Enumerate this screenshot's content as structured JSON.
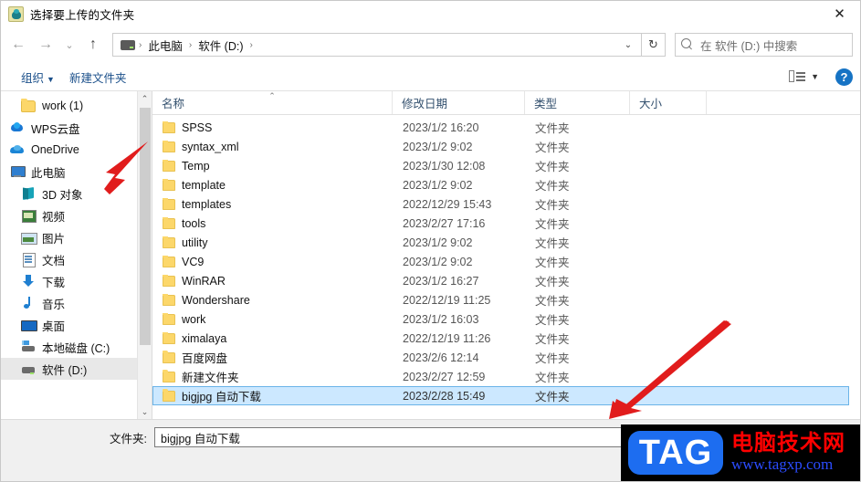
{
  "window": {
    "title": "选择要上传的文件夹",
    "title_icon": "app-icon",
    "close_label": "✕"
  },
  "nav": {
    "back_label": "←",
    "forward_label": "→",
    "history_label": "⌄",
    "up_label": "↑",
    "refresh_label": "↻",
    "dropdown_label": "⌄",
    "breadcrumb": [
      {
        "label": "此电脑"
      },
      {
        "label": "软件 (D:)"
      }
    ],
    "separator": "›"
  },
  "search": {
    "placeholder": "在 软件 (D:) 中搜索",
    "icon": "search-icon"
  },
  "toolbar": {
    "organize_label": "组织",
    "organize_caret": "▼",
    "new_folder_label": "新建文件夹",
    "view_caret": "▼",
    "help_label": "?"
  },
  "sidebar": {
    "items": [
      {
        "label": "work (1)",
        "icon": "folder-icon",
        "icon_class": "ico-folder",
        "indent": "sb-indent",
        "selected": false
      },
      {
        "label": "WPS云盘",
        "icon": "wps-cloud-icon",
        "icon_class": "ico-wps",
        "indent": "sb-root",
        "selected": false
      },
      {
        "label": "OneDrive",
        "icon": "onedrive-icon",
        "icon_class": "ico-onedrive",
        "indent": "sb-root",
        "selected": false
      },
      {
        "label": "此电脑",
        "icon": "this-pc-icon",
        "icon_class": "ico-pc",
        "indent": "sb-root",
        "selected": false
      },
      {
        "label": "3D 对象",
        "icon": "3d-objects-icon",
        "icon_class": "ico-3d",
        "indent": "sb-indent",
        "selected": false
      },
      {
        "label": "视频",
        "icon": "videos-icon",
        "icon_class": "ico-video",
        "indent": "sb-indent",
        "selected": false
      },
      {
        "label": "图片",
        "icon": "pictures-icon",
        "icon_class": "ico-pic",
        "indent": "sb-indent",
        "selected": false
      },
      {
        "label": "文档",
        "icon": "documents-icon",
        "icon_class": "ico-doc",
        "indent": "sb-indent",
        "selected": false
      },
      {
        "label": "下载",
        "icon": "downloads-icon",
        "icon_class": "ico-dl",
        "indent": "sb-indent",
        "selected": false
      },
      {
        "label": "音乐",
        "icon": "music-icon",
        "icon_class": "ico-music",
        "indent": "sb-indent",
        "selected": false
      },
      {
        "label": "桌面",
        "icon": "desktop-icon",
        "icon_class": "ico-desk",
        "indent": "sb-indent",
        "selected": false
      },
      {
        "label": "本地磁盘 (C:)",
        "icon": "local-disk-icon",
        "icon_class": "ico-diskc",
        "indent": "sb-indent",
        "selected": false
      },
      {
        "label": "软件 (D:)",
        "icon": "drive-icon",
        "icon_class": "ico-disk",
        "indent": "sb-indent",
        "selected": true
      }
    ],
    "scroll_up": "⌃",
    "scroll_down": "⌄"
  },
  "file_list": {
    "columns": [
      {
        "label": "名称",
        "class": "c-name"
      },
      {
        "label": "修改日期",
        "class": "c-date"
      },
      {
        "label": "类型",
        "class": "c-type"
      },
      {
        "label": "大小",
        "class": "c-size"
      }
    ],
    "sort_caret": "⌃",
    "rows": [
      {
        "name": "SPSS",
        "date": "2023/1/2 16:20",
        "type": "文件夹",
        "size": "",
        "selected": false
      },
      {
        "name": "syntax_xml",
        "date": "2023/1/2 9:02",
        "type": "文件夹",
        "size": "",
        "selected": false
      },
      {
        "name": "Temp",
        "date": "2023/1/30 12:08",
        "type": "文件夹",
        "size": "",
        "selected": false
      },
      {
        "name": "template",
        "date": "2023/1/2 9:02",
        "type": "文件夹",
        "size": "",
        "selected": false
      },
      {
        "name": "templates",
        "date": "2022/12/29 15:43",
        "type": "文件夹",
        "size": "",
        "selected": false
      },
      {
        "name": "tools",
        "date": "2023/2/27 17:16",
        "type": "文件夹",
        "size": "",
        "selected": false
      },
      {
        "name": "utility",
        "date": "2023/1/2 9:02",
        "type": "文件夹",
        "size": "",
        "selected": false
      },
      {
        "name": "VC9",
        "date": "2023/1/2 9:02",
        "type": "文件夹",
        "size": "",
        "selected": false
      },
      {
        "name": "WinRAR",
        "date": "2023/1/2 16:27",
        "type": "文件夹",
        "size": "",
        "selected": false
      },
      {
        "name": "Wondershare",
        "date": "2022/12/19 11:25",
        "type": "文件夹",
        "size": "",
        "selected": false
      },
      {
        "name": "work",
        "date": "2023/1/2 16:03",
        "type": "文件夹",
        "size": "",
        "selected": false
      },
      {
        "name": "ximalaya",
        "date": "2022/12/19 11:26",
        "type": "文件夹",
        "size": "",
        "selected": false
      },
      {
        "name": "百度网盘",
        "date": "2023/2/6 12:14",
        "type": "文件夹",
        "size": "",
        "selected": false
      },
      {
        "name": "新建文件夹",
        "date": "2023/2/27 12:59",
        "type": "文件夹",
        "size": "",
        "selected": false
      },
      {
        "name": "bigjpg 自动下载",
        "date": "2023/2/28 15:49",
        "type": "文件夹",
        "size": "",
        "selected": true
      }
    ]
  },
  "footer": {
    "folder_label": "文件夹:",
    "folder_value": "bigjpg 自动下载"
  },
  "watermark": {
    "tag": "TAG",
    "cn_text": "电脑技术网",
    "url": "www.tagxp.com"
  },
  "colors": {
    "accent": "#1673c4",
    "selection": "#cce8ff",
    "selection_border": "#6ab3e8",
    "annotation_arrow": "#e11c1c",
    "folder_icon": "#fcd76a"
  }
}
